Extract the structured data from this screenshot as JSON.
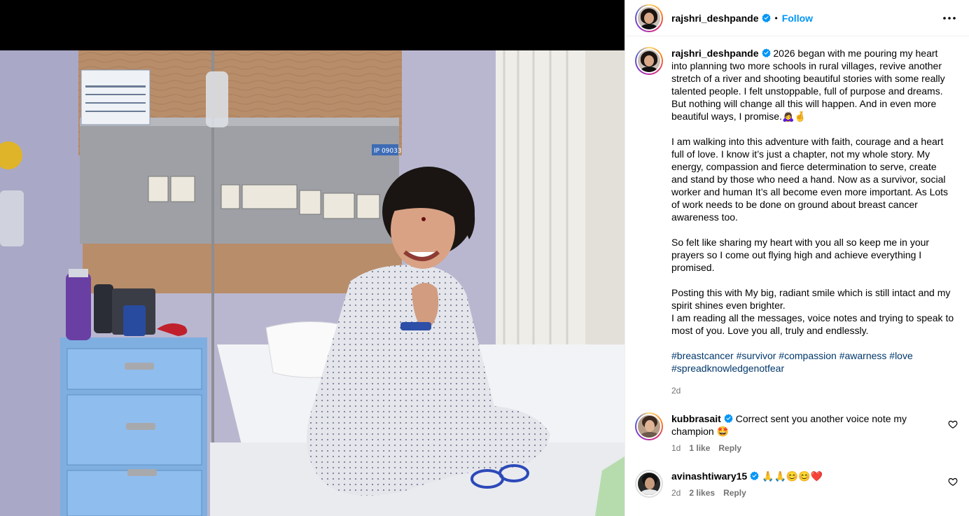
{
  "post": {
    "author": "rajshri_deshpande",
    "follow_label": "Follow",
    "separator": "•",
    "caption_paragraphs": [
      "2026 began with me pouring my heart into planning two more schools in rural villages, revive another stretch of a river and shooting beautiful stories with some really talented people. I felt unstoppable, full of purpose and dreams. But nothing will change all this will happen. And in even more beautiful ways, I promise.🙇‍♀️🤞",
      "I am walking into this adventure with faith, courage and a heart full of love. I know it’s just a chapter, not my whole story. My energy, compassion and fierce determination to serve, create and stand by those who need a hand. Now as a survivor, social worker and human It’s all become even more important. As Lots of work needs to be done on ground about breast cancer awareness too.",
      "So felt like sharing my heart with you all so keep me in your prayers so I come out flying high and achieve everything I promised.",
      "Posting this with My big, radiant smile which is still intact and my spirit shines even brighter.\nI am reading all the messages, voice notes and trying to speak to most of you. Love you all, truly and endlessly."
    ],
    "hashtags": [
      "#breastcancer",
      "#survivor",
      "#compassion",
      "#awarness",
      "#love",
      "#spreadknowledgenotfear"
    ],
    "time": "2d",
    "photo_sign": "IP 09033"
  },
  "comments": [
    {
      "user": "kubbrasait",
      "text": "Correct sent you another voice note my champion 🤩",
      "time": "1d",
      "likes": "1 like",
      "reply": "Reply"
    },
    {
      "user": "avinashtiwary15",
      "text": "🙏🙏😊😊❤️",
      "time": "2d",
      "likes": "2 likes",
      "reply": "Reply"
    }
  ],
  "colors": {
    "accent": "#0095f6",
    "hashtag": "#00376b",
    "muted": "#737373",
    "verified": "#0095f6"
  },
  "icons": {
    "more": "more-horizontal-icon",
    "verified": "verified-badge-icon",
    "like": "heart-icon"
  }
}
